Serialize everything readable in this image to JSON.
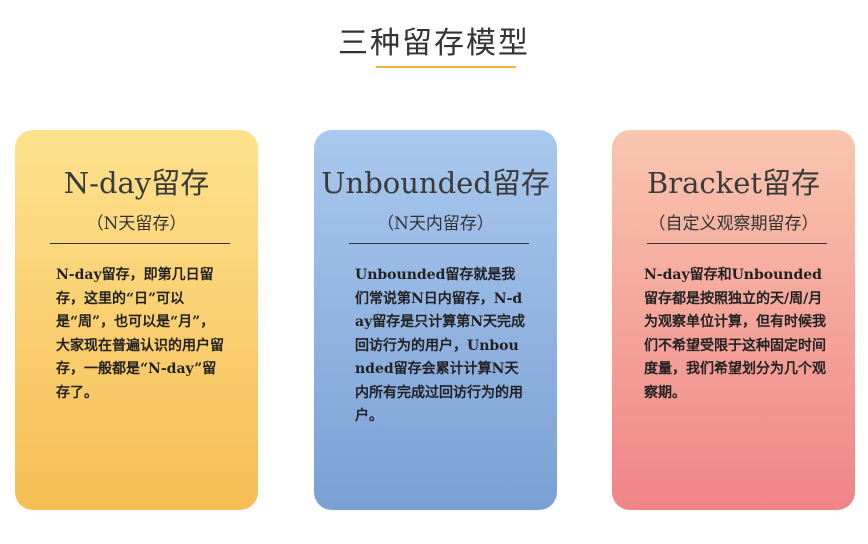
{
  "title": "三种留存模型",
  "colors": {
    "title_underline": "#f2b233",
    "card_1": [
      "#fde28e",
      "#f7bd55"
    ],
    "card_2": [
      "#a9c8ee",
      "#7aa0d4"
    ],
    "card_3": [
      "#f9c6ae",
      "#f08487"
    ]
  },
  "cards": [
    {
      "title": "N-day留存",
      "subtitle": "（N天留存）",
      "body": "N-day留存，即第几日留存，这里的“日”可以是“周”，也可以是“月”，大家现在普遍认识的用户留存，一般都是“N-day”留存了。"
    },
    {
      "title": "Unbounded留存",
      "subtitle": "（N天内留存）",
      "body": "Unbounded留存就是我们常说第N日内留存，N-day留存是只计算第N天完成回访行为的用户，Unbounded留存会累计计算N天内所有完成过回访行为的用户。"
    },
    {
      "title": "Bracket留存",
      "subtitle": "（自定义观察期留存）",
      "body": "N-day留存和Unbounded留存都是按照独立的天/周/月为观察单位计算，但有时候我们不希望受限于这种固定时间度量，我们希望划分为几个观察期。"
    }
  ]
}
